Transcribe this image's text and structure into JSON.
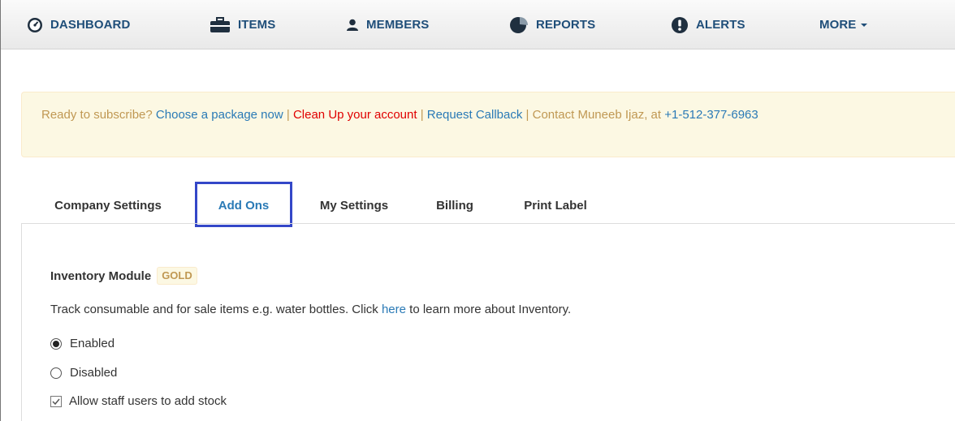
{
  "nav": {
    "items": [
      {
        "label": "DASHBOARD",
        "icon": "dashboard-icon"
      },
      {
        "label": "ITEMS",
        "icon": "briefcase-icon"
      },
      {
        "label": "MEMBERS",
        "icon": "user-icon"
      },
      {
        "label": "REPORTS",
        "icon": "pie-chart-icon"
      },
      {
        "label": "ALERTS",
        "icon": "exclamation-icon"
      },
      {
        "label": "MORE",
        "icon": "caret-down-icon"
      }
    ]
  },
  "alert": {
    "prefix": "Ready to subscribe?",
    "choose_package": "Choose a package now",
    "sep1": "|",
    "clean_up": "Clean Up your account",
    "sep2": "|",
    "request_callback": "Request Callback",
    "sep3": "|",
    "contact_text": "Contact Muneeb Ijaz, at",
    "phone": "+1-512-377-6963"
  },
  "tabs": [
    {
      "label": "Company Settings",
      "active": false
    },
    {
      "label": "Add Ons",
      "active": true
    },
    {
      "label": "My Settings",
      "active": false
    },
    {
      "label": "Billing",
      "active": false
    },
    {
      "label": "Print Label",
      "active": false
    }
  ],
  "module": {
    "title": "Inventory Module",
    "badge": "GOLD",
    "description_before": "Track consumable and for sale items e.g. water bottles. Click",
    "description_link": "here",
    "description_after": "to learn more about Inventory.",
    "options": [
      {
        "label": "Enabled",
        "selected": true
      },
      {
        "label": "Disabled",
        "selected": false
      }
    ],
    "checkbox": {
      "label": "Allow staff users to add stock",
      "checked": true
    }
  },
  "colors": {
    "nav_text": "#1f4e79",
    "link": "#2a7ab6",
    "danger_link": "#e00000",
    "alert_bg": "#fcf8e3",
    "highlight_border": "#3447c8"
  }
}
